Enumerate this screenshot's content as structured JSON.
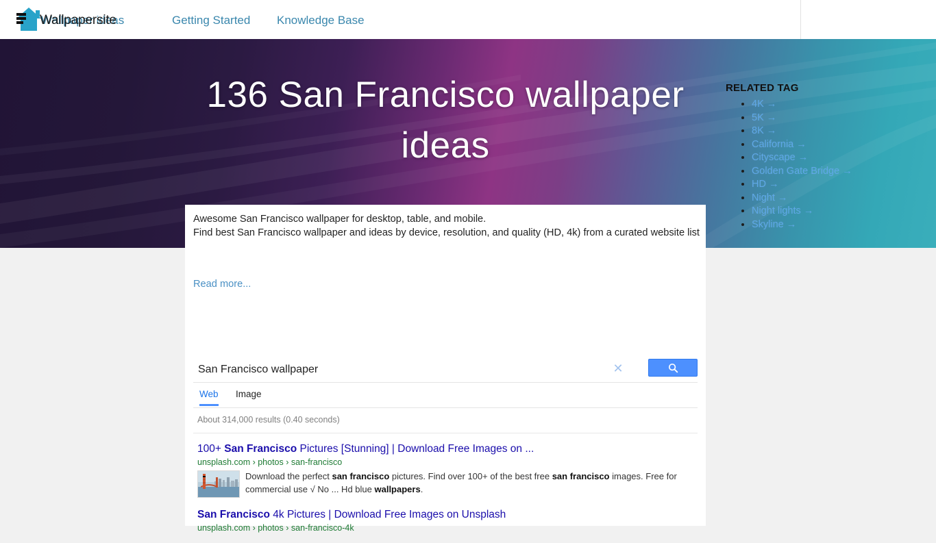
{
  "header": {
    "logo_icon": "house-logo-icon",
    "brand_name": "Wallpapersite",
    "nav": [
      {
        "label": "Wallpaper ideas",
        "name": "nav-wallpaper-ideas"
      },
      {
        "label": "Getting Started",
        "name": "nav-getting-started"
      },
      {
        "label": "Knowledge Base",
        "name": "nav-knowledge-base"
      }
    ]
  },
  "hero": {
    "title": "136 San Francisco wallpaper ideas",
    "accent_purple": "#6a2a72",
    "accent_teal": "#3aaebb"
  },
  "related_tags": {
    "heading": "RELATED TAG",
    "arrow_glyph": "→",
    "items": [
      {
        "label": "4K"
      },
      {
        "label": "5K"
      },
      {
        "label": "8K"
      },
      {
        "label": "California"
      },
      {
        "label": "Cityscape"
      },
      {
        "label": "Golden Gate Bridge"
      },
      {
        "label": "HD"
      },
      {
        "label": "Night"
      },
      {
        "label": "Night lights"
      },
      {
        "label": "Skyline"
      }
    ]
  },
  "description": {
    "line1": "Awesome San Francisco wallpaper for desktop, table, and mobile.",
    "line2": "Find best San Francisco wallpaper and ideas by device, resolution, and quality (HD, 4k) from a curated website list",
    "read_more": "Read more..."
  },
  "search": {
    "query_value": "San Francisco wallpaper",
    "placeholder": "Search",
    "clear_icon": "close-x-icon",
    "submit_icon": "magnifier-icon",
    "tabs": [
      {
        "label": "Web",
        "active": true
      },
      {
        "label": "Image",
        "active": false
      }
    ],
    "results_count": "About 314,000 results (0.40 seconds)"
  },
  "results": [
    {
      "title_prefix": "100+ ",
      "title_bold": "San Francisco",
      "title_suffix": " Pictures [Stunning] | Download Free Images on ...",
      "url": "unsplash.com › photos › san-francisco",
      "thumb": "golden-gate-bridge-thumbnail",
      "snippet_parts": [
        {
          "text": "Download the perfect ",
          "bold": false
        },
        {
          "text": "san francisco",
          "bold": true
        },
        {
          "text": " pictures. Find over 100+ of the best free ",
          "bold": false
        },
        {
          "text": "san francisco",
          "bold": true
        },
        {
          "text": " images. Free for commercial use √ No ... Hd blue ",
          "bold": false
        },
        {
          "text": "wallpapers",
          "bold": true
        },
        {
          "text": ".",
          "bold": false
        }
      ]
    },
    {
      "title_prefix": "",
      "title_bold": "San Francisco",
      "title_suffix": " 4k Pictures | Download Free Images on Unsplash",
      "url": "unsplash.com › photos › san-francisco-4k",
      "thumb": null,
      "snippet_parts": []
    }
  ]
}
